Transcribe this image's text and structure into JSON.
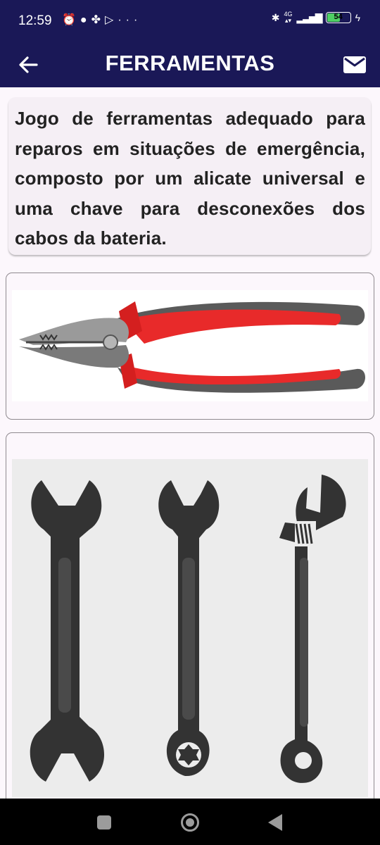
{
  "status_bar": {
    "time": "12:59",
    "left_icons": [
      "mute-alarm-icon",
      "chat-icon",
      "fan-icon",
      "play-icon",
      "more-dots-icon"
    ],
    "network": "4G",
    "battery": "54",
    "battery_level": 0.54
  },
  "app_bar": {
    "title": "FERRAMENTAS",
    "back_icon": "arrow-left-icon",
    "action_icon": "mail-icon"
  },
  "description": "Jogo de ferramentas adequado para reparos em situações de emergência, composto por um alicate universal e uma chave para desconexões dos cabos da bateria.",
  "images": [
    {
      "subject": "pliers",
      "colors": {
        "handle": "#e82a2a",
        "grip": "#555555",
        "head": "#8a8a8a"
      }
    },
    {
      "subject": "wrenches",
      "colors": {
        "tool": "#333333",
        "background": "#ececec"
      }
    }
  ],
  "colors": {
    "primary": "#1a1857",
    "background": "#fcf7fc",
    "card": "#f5eff5"
  }
}
